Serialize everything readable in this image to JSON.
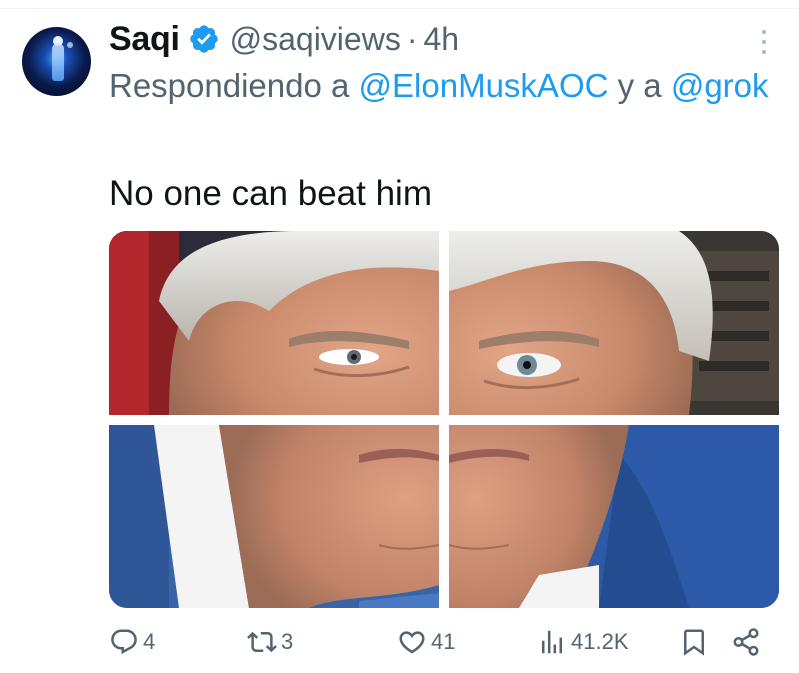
{
  "tweet": {
    "display_name": "Saqi",
    "handle": "@saqiviews",
    "separator": "·",
    "time": "4h",
    "verified": true,
    "reply_prefix": "Respondiendo a",
    "reply_mention_1": "@ElonMuskAOC",
    "reply_conjunction": "y a",
    "reply_mention_2": "@grok",
    "text": "No one can beat him",
    "media": {
      "tiles": 4,
      "subject": "close-up of man's face split into four tiles"
    }
  },
  "actions": {
    "reply_count": "4",
    "retweet_count": "3",
    "like_count": "41",
    "views_count": "41.2K"
  },
  "icons": {
    "verified": "verified-badge-icon",
    "more": "more-vertical-icon",
    "reply": "reply-icon",
    "retweet": "retweet-icon",
    "like": "heart-icon",
    "views": "views-chart-icon",
    "bookmark": "bookmark-icon",
    "share": "share-icon"
  },
  "colors": {
    "accent": "#1d9bf0",
    "secondary_text": "#536471",
    "primary_text": "#0f1419"
  }
}
